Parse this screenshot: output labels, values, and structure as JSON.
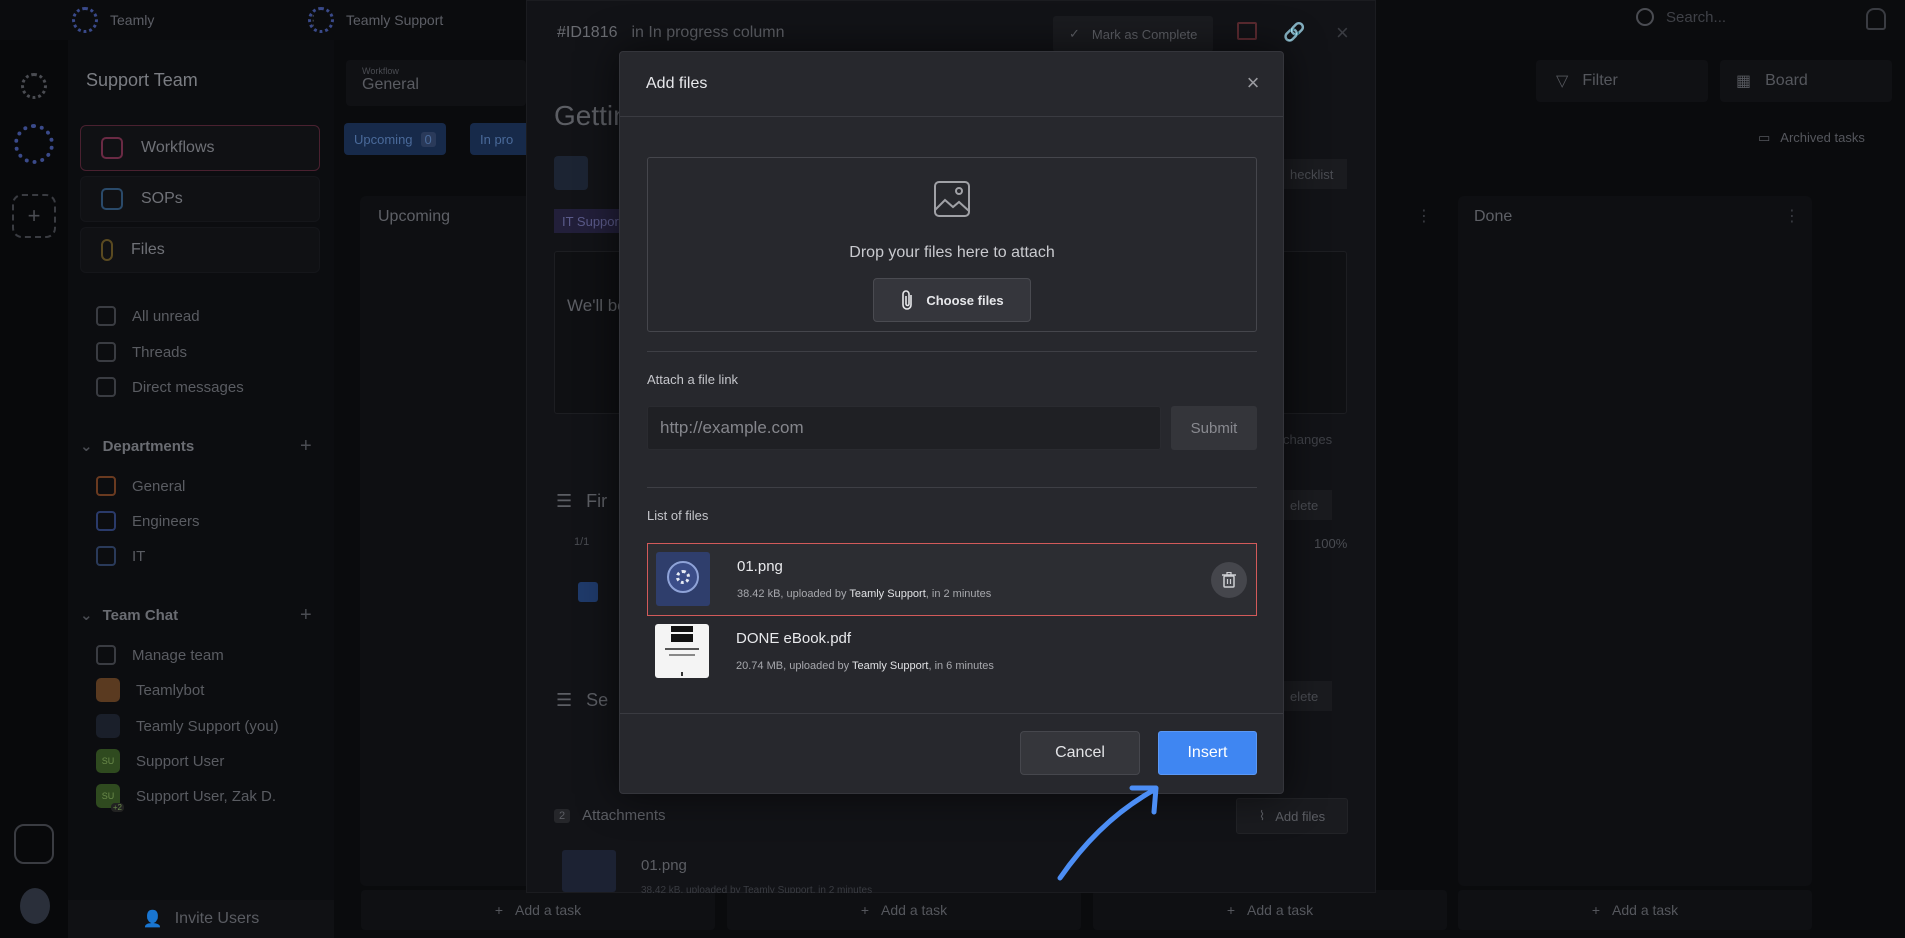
{
  "colors": {
    "accent": "#3f86f2",
    "selected_border": "#d25a5a",
    "modal_bg": "#27282d"
  },
  "topbar": {
    "tabs": [
      {
        "label": "Teamly"
      },
      {
        "label": "Teamly Support"
      }
    ],
    "search_placeholder": "Search..."
  },
  "sidebar": {
    "team_title": "Support Team",
    "nav": [
      {
        "label": "Workflows"
      },
      {
        "label": "SOPs"
      },
      {
        "label": "Files"
      }
    ],
    "inbox": [
      {
        "label": "All unread"
      },
      {
        "label": "Threads"
      },
      {
        "label": "Direct messages"
      }
    ],
    "departments_title": "Departments",
    "departments": [
      {
        "label": "General"
      },
      {
        "label": "Engineers"
      },
      {
        "label": "IT"
      }
    ],
    "team_chat_title": "Team Chat",
    "team_chat": [
      {
        "label": "Manage team"
      },
      {
        "label": "Teamlybot"
      },
      {
        "label": "Teamly Support (you)"
      },
      {
        "label": "Support User",
        "initials": "SU"
      },
      {
        "label": "Support User, Zak D.",
        "initials": "SU",
        "badge": "+2"
      }
    ],
    "invite_label": "Invite Users"
  },
  "board": {
    "workflow_label": "Workflow",
    "workflow_value": "General",
    "filter_label": "Filter",
    "view_label": "Board",
    "archived_label": "Archived tasks",
    "chips": [
      {
        "label": "Upcoming",
        "count": "0"
      },
      {
        "label": "In pro"
      }
    ],
    "columns": [
      {
        "title": "Upcoming"
      },
      {
        "title": ""
      },
      {
        "title": ""
      },
      {
        "title": "Done"
      }
    ],
    "add_task_label": "Add a task"
  },
  "task": {
    "id": "#ID1816",
    "location": "in In progress column",
    "mark_complete": "Mark as Complete",
    "title_partial": "Gettin",
    "tag": "IT Suppor",
    "body_partial": "We'll be",
    "checklist_label": "hecklist",
    "changes_label": "changes",
    "delete_label": "elete",
    "progress_count": "1/1",
    "progress_percent": "100%",
    "section1_partial": "Fir",
    "section2_partial": "Se",
    "attachments_count": "2",
    "attachments_label": "Attachments",
    "add_files_label": "Add files",
    "attachment_file": "01.png",
    "attachment_meta": "38.42 kB, uploaded by Teamly Support, in 2 minutes"
  },
  "modal": {
    "title": "Add files",
    "drop_text": "Drop your files here to attach",
    "choose_files": "Choose files",
    "link_label": "Attach a file link",
    "link_placeholder": "http://example.com",
    "submit": "Submit",
    "list_label": "List of files",
    "files": [
      {
        "name": "01.png",
        "size": "38.42 kB",
        "uploaded_by_prefix": ", uploaded by ",
        "uploader": "Teamly Support",
        "time": ", in 2 minutes"
      },
      {
        "name": "DONE eBook.pdf",
        "size": "20.74 MB",
        "uploaded_by_prefix": ", uploaded by ",
        "uploader": "Teamly Support",
        "time": ", in 6 minutes"
      }
    ],
    "cancel": "Cancel",
    "insert": "Insert"
  }
}
